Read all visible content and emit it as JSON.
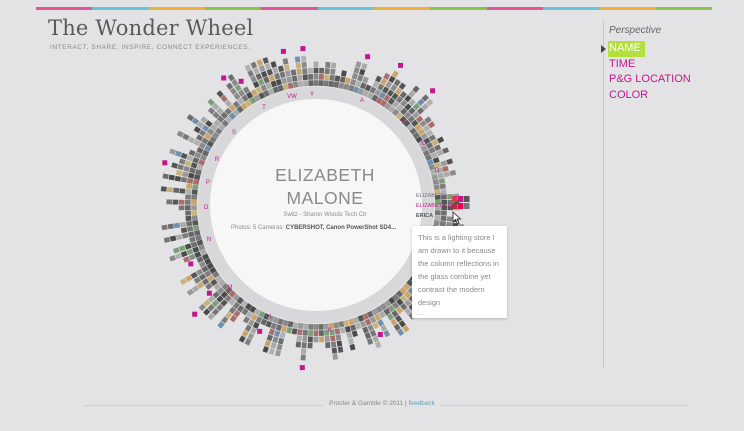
{
  "app": {
    "title": "The Wonder Wheel",
    "subtitle": "INTERACT, SHARE, INSPIRE, CONNECT EXPERIENCES."
  },
  "perspective": {
    "label": "Perspective",
    "items": [
      {
        "label": "NAME",
        "active": true
      },
      {
        "label": "TIME",
        "active": false
      },
      {
        "label": "P&G LOCATION",
        "active": false
      },
      {
        "label": "COLOR",
        "active": false
      }
    ]
  },
  "selected_person": {
    "first_name": "ELIZABETH",
    "last_name": "MALONE",
    "location": "Switz - Sharon Woods Tech Ctr",
    "photos_label": "Photos:",
    "photos_count": "5",
    "cameras_label": "Cameras:",
    "cameras": "CYBERSHOT, Canon PowerShot SD4..."
  },
  "name_list": [
    "ELIZABETH",
    "ELIZABETH MA",
    "ERICA"
  ],
  "tooltip": {
    "text": "This is a lighting store I am drawn to it because the column reflections in the glass combine yet contrast the modern design",
    "more": "..."
  },
  "wheel_letters": [
    "Y",
    "A",
    "B",
    "C",
    "D",
    "J",
    "K",
    "L",
    "M",
    "N",
    "O",
    "P",
    "R",
    "S",
    "T",
    "VW"
  ],
  "footer": {
    "company": "Procter & Gamble",
    "copyright": "© 2011",
    "separator": "|",
    "feedback": "feedback"
  },
  "colors": {
    "accent_magenta": "#c2188b",
    "accent_green": "#b4e03d",
    "background": "#e3e3e5",
    "top_strip": [
      "#e3559b",
      "#67c4d9",
      "#f0b13b",
      "#8bc34a",
      "#e3559b",
      "#67c4d9",
      "#f0b13b",
      "#8bc34a",
      "#e3559b",
      "#67c4d9",
      "#f0b13b",
      "#8bc34a"
    ]
  }
}
